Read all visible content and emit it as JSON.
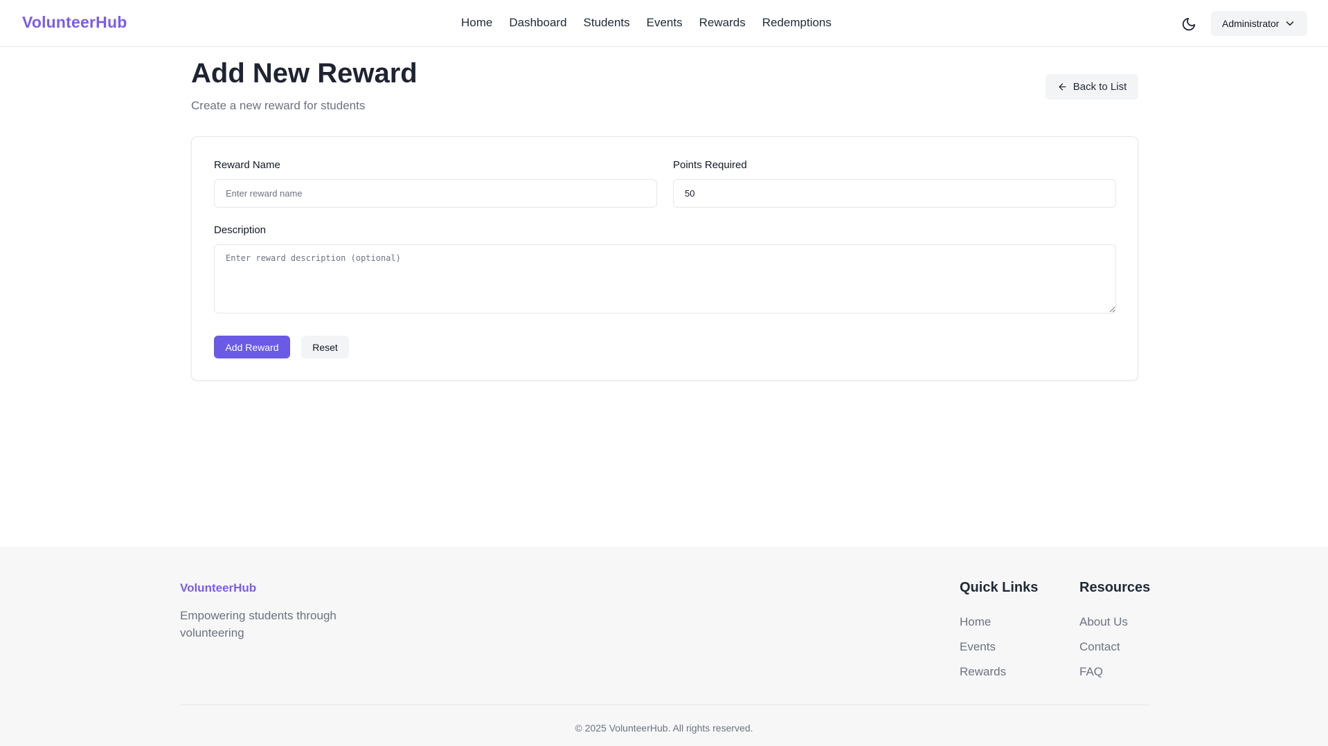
{
  "header": {
    "brand": "VolunteerHub",
    "nav": [
      "Home",
      "Dashboard",
      "Students",
      "Events",
      "Rewards",
      "Redemptions"
    ],
    "theme_icon": "moon-icon",
    "user_menu_label": "Administrator"
  },
  "page": {
    "title": "Add New Reward",
    "subtitle": "Create a new reward for students",
    "back_label": "Back to List"
  },
  "form": {
    "reward_name_label": "Reward Name",
    "reward_name_placeholder": "Enter reward name",
    "reward_name_value": "",
    "points_label": "Points Required",
    "points_value": "50",
    "description_label": "Description",
    "description_placeholder": "Enter reward description (optional)",
    "submit_label": "Add Reward",
    "reset_label": "Reset"
  },
  "footer": {
    "brand": "VolunteerHub",
    "tagline": "Empowering students through volunteering",
    "quick_links_title": "Quick Links",
    "quick_links": [
      "Home",
      "Events",
      "Rewards"
    ],
    "resources_title": "Resources",
    "resources": [
      "About Us",
      "Contact",
      "FAQ"
    ],
    "copyright": "© 2025 VolunteerHub. All rights reserved."
  },
  "colors": {
    "brand": "#7c5ce8",
    "primary_button": "#6a5ae6"
  }
}
